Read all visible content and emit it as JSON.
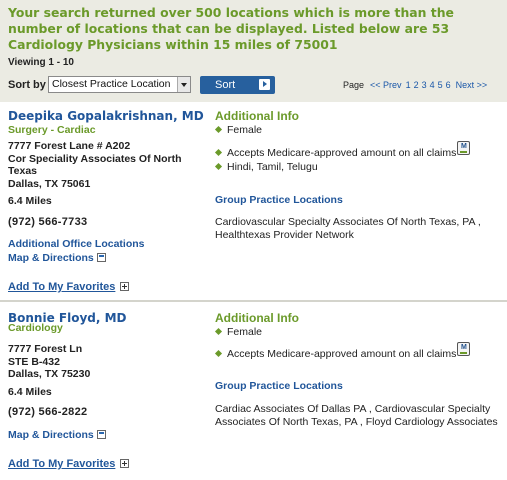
{
  "header": {
    "message": "Your search returned over 500 locations which is more than the number of locations that can be displayed. Listed below are 53 Cardiology Physicians within 15 miles of 75001",
    "viewing": "Viewing 1 - 10",
    "sort_by_label": "Sort by",
    "sort_selected": "Closest Practice Location",
    "sort_button": "Sort",
    "pager": {
      "page_label": "Page",
      "prev": "<< Prev",
      "pages": [
        "1",
        "2",
        "3",
        "4",
        "5",
        "6"
      ],
      "next": "Next >>"
    }
  },
  "results": [
    {
      "name": "Deepika Gopalakrishnan, MD",
      "specialty": "Surgery - Cardiac",
      "address": "7777 Forest Lane # A202\nCor Speciality Associates Of North Texas\nDallas, TX 75061",
      "distance": "6.4 Miles",
      "phone": "(972) 566-7733",
      "additional_office_locations": "Additional Office Locations",
      "map_directions": "Map & Directions",
      "add_favorites": "Add To My Favorites",
      "additional_info_heading": "Additional Info",
      "gender": "Female",
      "medicare": "Accepts Medicare-approved amount on all claims",
      "languages": "Hindi, Tamil, Telugu",
      "group_heading": "Group Practice Locations",
      "group_locations": "Cardiovascular Specialty Associates Of North Texas, PA , Healthtexas Provider Network"
    },
    {
      "name": "Bonnie Floyd, MD",
      "specialty": "Cardiology",
      "address": "7777 Forest Ln\nSTE B-432\nDallas, TX 75230",
      "distance": "6.4 Miles",
      "phone": "(972) 566-2822",
      "map_directions": "Map & Directions",
      "add_favorites": "Add To My Favorites",
      "additional_info_heading": "Additional Info",
      "gender": "Female",
      "medicare": "Accepts Medicare-approved amount on all claims",
      "group_heading": "Group Practice Locations",
      "group_locations": "Cardiac Associates Of Dallas PA , Cardiovascular Specialty Associates Of North Texas, PA , Floyd Cardiology Associates"
    }
  ],
  "icons": {
    "medicare_badge": "medicare-badge-icon",
    "popup_window": "popup-window-icon",
    "add_plus": "plus-box-icon"
  },
  "colors": {
    "heading_green": "#6b9a2a",
    "link_blue": "#21569a",
    "sort_button": "#27609e",
    "header_bg": "#ebebe3"
  }
}
